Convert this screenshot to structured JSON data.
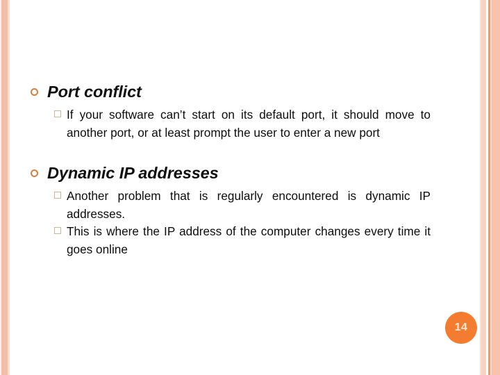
{
  "slide": {
    "page_number": "14",
    "accent_color": "#f47c30",
    "stripe_color": "#f5bca6",
    "bullet_ring_color": "#d2803f",
    "bullet_square_color": "#c9b79a",
    "sections": [
      {
        "heading": "Port conflict",
        "bullets": [
          "If your software can’t start on its default port, it should move to another port, or at least prompt the user to enter a new port"
        ]
      },
      {
        "heading": "Dynamic IP addresses",
        "bullets": [
          "Another problem that is regularly encountered is dynamic IP addresses.",
          "This is where the IP address of the computer changes every time it goes online"
        ]
      }
    ]
  }
}
